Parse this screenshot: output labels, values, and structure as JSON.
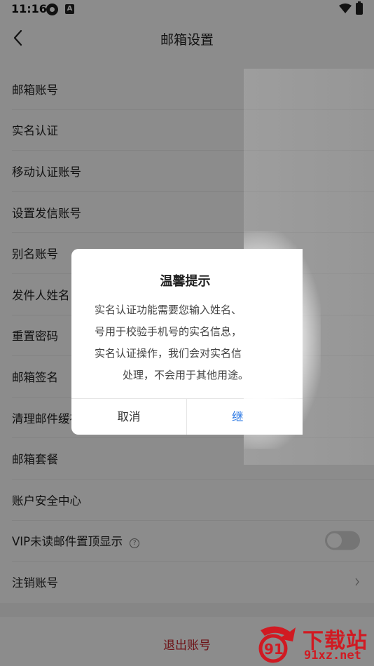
{
  "status_bar": {
    "time": "11:16",
    "icon_b": "A"
  },
  "header": {
    "title": "邮箱设置"
  },
  "list": {
    "items": [
      {
        "label": "邮箱账号"
      },
      {
        "label": "实名认证"
      },
      {
        "label": "移动认证账号"
      },
      {
        "label": "设置发信账号"
      },
      {
        "label": "别名账号"
      },
      {
        "label": "发件人姓名"
      },
      {
        "label": "重置密码"
      },
      {
        "label": "邮箱签名"
      },
      {
        "label": "清理邮件缓存"
      },
      {
        "label": "邮箱套餐"
      },
      {
        "label": "账户安全中心"
      },
      {
        "label": "VIP未读邮件置顶显示",
        "toggle": false
      },
      {
        "label": "注销账号"
      }
    ]
  },
  "logout": {
    "label": "退出账号"
  },
  "dialog": {
    "title": "温馨提示",
    "body": [
      "实名认证功能需要您输入姓名、",
      "号用于校验手机号的实名信息，",
      "实名认证操作，我们会对实名信",
      "处理，不会用于其他用途。"
    ],
    "cancel_label": "取消",
    "confirm_label": "继"
  },
  "watermark": {
    "title": "下载站",
    "url": "91xz.net",
    "badge": "91"
  },
  "colors": {
    "accent": "#2b78e4",
    "danger": "#c8232c",
    "watermark": "#d11a22"
  }
}
